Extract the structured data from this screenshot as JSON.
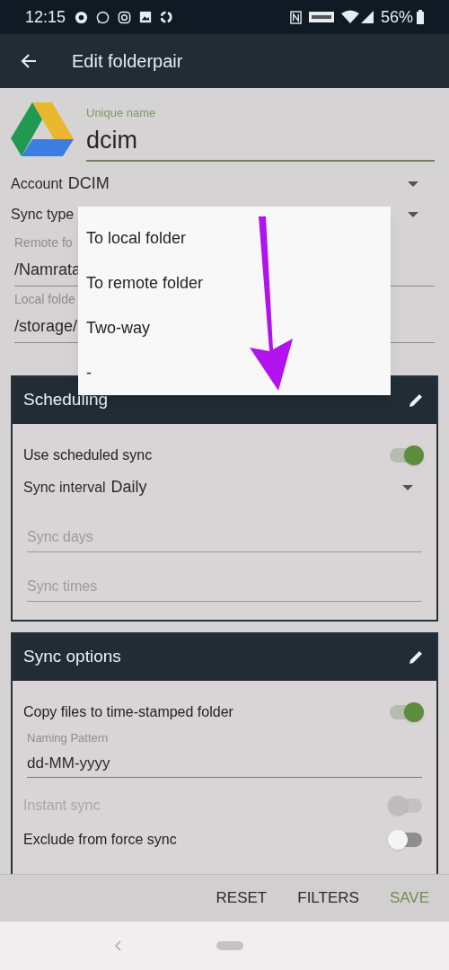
{
  "status_bar": {
    "time": "12:15",
    "battery": "56%"
  },
  "app_bar": {
    "title": "Edit folderpair"
  },
  "folderpair": {
    "unique_name": {
      "label": "Unique name",
      "value": "dcim"
    },
    "account": {
      "label": "Account",
      "value": "DCIM"
    },
    "sync_type": {
      "label": "Sync type"
    },
    "remote_folder": {
      "label": "Remote fo",
      "value": "/Namrata"
    },
    "local_folder": {
      "label": "Local folde",
      "value": "/storage/"
    }
  },
  "dropdown": {
    "options": [
      {
        "label": "To local folder"
      },
      {
        "label": "To remote folder"
      },
      {
        "label": "Two-way"
      },
      {
        "label": "-"
      }
    ]
  },
  "sections": [
    {
      "title": "Scheduling",
      "rows": [
        {
          "kind": "switch",
          "label": "Use scheduled sync",
          "on": true,
          "disabled": false
        },
        {
          "kind": "dropdown",
          "label": "Sync interval",
          "value": "Daily"
        },
        {
          "kind": "field",
          "placeholder": "Sync days"
        },
        {
          "kind": "field",
          "placeholder": "Sync times"
        }
      ]
    },
    {
      "title": "Sync options",
      "rows": [
        {
          "kind": "switch",
          "label": "Copy files to time-stamped folder",
          "on": true,
          "disabled": false
        },
        {
          "kind": "labeled_field",
          "label": "Naming Pattern",
          "value": "dd-MM-yyyy"
        },
        {
          "kind": "switch",
          "label": "Instant sync",
          "on": false,
          "disabled": true
        },
        {
          "kind": "switch",
          "label": "Exclude from force sync",
          "on": false,
          "disabled": false
        }
      ]
    }
  ],
  "bottom_bar": {
    "buttons": [
      {
        "label": "RESET",
        "kind": "plain"
      },
      {
        "label": "FILTERS",
        "kind": "plain"
      },
      {
        "label": "SAVE",
        "kind": "primary"
      }
    ]
  }
}
